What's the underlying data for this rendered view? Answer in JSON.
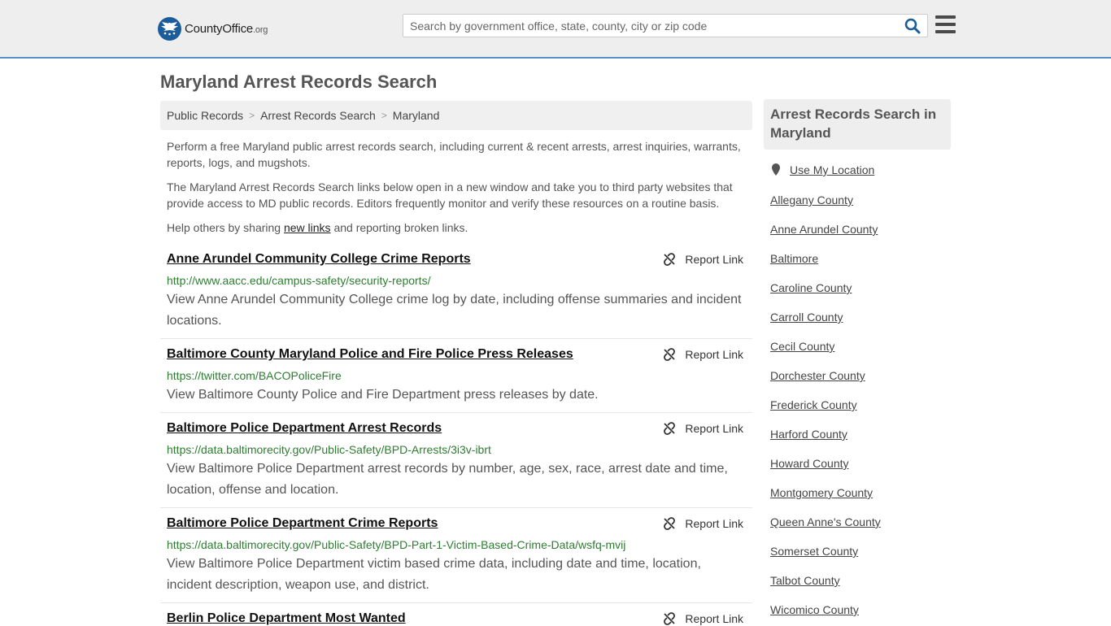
{
  "header": {
    "logo_main": "County",
    "logo_office": "Office",
    "logo_tld": ".org",
    "search_placeholder": "Search by government office, state, county, city or zip code",
    "search_icon": "magnifier-icon",
    "menu_icon": "hamburger-menu-icon"
  },
  "page": {
    "title": "Maryland Arrest Records Search"
  },
  "breadcrumb": [
    "Public Records",
    "Arrest Records Search",
    "Maryland"
  ],
  "intro": {
    "p1": "Perform a free Maryland public arrest records search, including current & recent arrests, arrest inquiries, warrants, reports, logs, and mugshots.",
    "p2": "The Maryland Arrest Records Search links below open in a new window and take you to third party websites that provide access to MD public records. Editors frequently monitor and verify these resources on a routine basis.",
    "p3_before": "Help others by sharing ",
    "p3_link": "new links",
    "p3_after": " and reporting broken links."
  },
  "report_label": "Report Link",
  "results": [
    {
      "title": "Anne Arundel Community College Crime Reports",
      "url": "http://www.aacc.edu/campus-safety/security-reports/",
      "desc": "View Anne Arundel Community College crime log by date, including offense summaries and incident locations."
    },
    {
      "title": "Baltimore County Maryland Police and Fire Police Press Releases",
      "url": "https://twitter.com/BACOPoliceFire",
      "desc": "View Baltimore County Police and Fire Department press releases by date."
    },
    {
      "title": "Baltimore Police Department Arrest Records",
      "url": "https://data.baltimorecity.gov/Public-Safety/BPD-Arrests/3i3v-ibrt",
      "desc": "View Baltimore Police Department arrest records by number, age, sex, race, arrest date and time, location, offense and location."
    },
    {
      "title": "Baltimore Police Department Crime Reports",
      "url": "https://data.baltimorecity.gov/Public-Safety/BPD-Part-1-Victim-Based-Crime-Data/wsfq-mvij",
      "desc": "View Baltimore Police Department victim based crime data, including date and time, location, incident description, weapon use, and district."
    },
    {
      "title": "Berlin Police Department Most Wanted",
      "url": "",
      "desc": ""
    }
  ],
  "sidebar": {
    "heading": "Arrest Records Search in Maryland",
    "use_location": "Use My Location",
    "counties": [
      "Allegany County",
      "Anne Arundel County",
      "Baltimore",
      "Caroline County",
      "Carroll County",
      "Cecil County",
      "Dorchester County",
      "Frederick County",
      "Harford County",
      "Howard County",
      "Montgomery County",
      "Queen Anne's County",
      "Somerset County",
      "Talbot County",
      "Wicomico County"
    ]
  }
}
